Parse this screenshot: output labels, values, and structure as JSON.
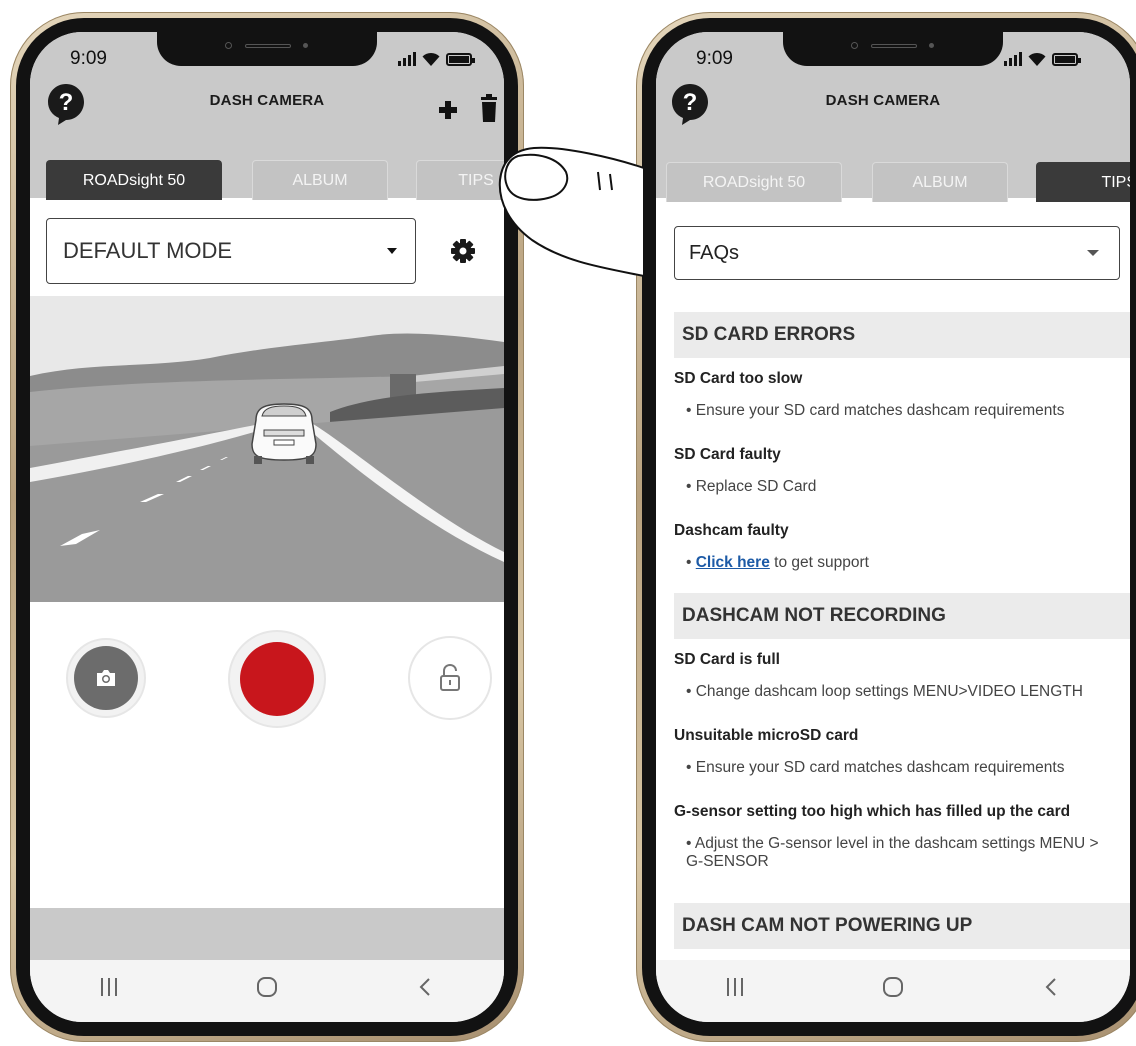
{
  "left_phone": {
    "status": {
      "time": "9:09"
    },
    "header": {
      "title": "DASH CAMERA",
      "help_icon": "question-bubble-icon",
      "add_icon": "plus-icon",
      "delete_icon": "trash-icon"
    },
    "tabs": [
      {
        "label": "ROADsight 50",
        "active": true
      },
      {
        "label": "ALBUM",
        "active": false
      },
      {
        "label": "TIPS",
        "active": false
      }
    ],
    "mode_select": {
      "value": "DEFAULT MODE"
    },
    "settings_icon": "gear-icon",
    "controls": {
      "photo_icon": "camera-icon",
      "record_color": "#c8161c",
      "lock_icon": "unlock-icon"
    },
    "nav": {
      "recents": "|||",
      "home": "○",
      "back": "‹"
    }
  },
  "right_phone": {
    "status": {
      "time": "9:09"
    },
    "header": {
      "title": "DASH CAMERA",
      "help_icon": "question-bubble-icon"
    },
    "tabs": [
      {
        "label": "ROADsight 50",
        "active": false
      },
      {
        "label": "ALBUM",
        "active": false
      },
      {
        "label": "TIPS",
        "active": true
      }
    ],
    "faq_select": {
      "value": "FAQs"
    },
    "sections": [
      {
        "heading": "SD CARD ERRORS",
        "items": [
          {
            "q": "SD Card too slow",
            "a": "Ensure your SD card matches dashcam requirements"
          },
          {
            "q": "SD Card faulty",
            "a": "Replace SD Card"
          },
          {
            "q": "Dashcam faulty",
            "a_link": "Click here",
            "a_rest": " to get support"
          }
        ]
      },
      {
        "heading": "DASHCAM NOT RECORDING",
        "items": [
          {
            "q": "SD Card is full",
            "a": "Change dashcam loop settings MENU>VIDEO LENGTH"
          },
          {
            "q": "Unsuitable microSD card",
            "a": "Ensure your SD card matches dashcam requirements"
          },
          {
            "q": "G-sensor setting too high which has filled up the card",
            "a": "Adjust the G-sensor level in the dashcam settings MENU > G-SENSOR"
          }
        ]
      },
      {
        "heading": "DASH CAM NOT POWERING UP",
        "items": []
      }
    ],
    "nav": {
      "recents": "|||",
      "home": "○",
      "back": "‹"
    }
  },
  "colors": {
    "header_gray": "#c9c9c9",
    "tab_active": "#3a3a3a",
    "record_red": "#c8161c",
    "link_blue": "#1c5aa6"
  }
}
